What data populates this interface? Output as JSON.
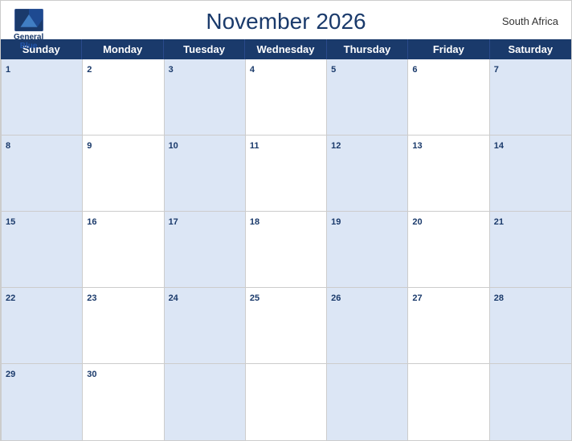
{
  "header": {
    "title": "November 2026",
    "country": "South Africa",
    "logo": {
      "line1": "General",
      "line2": "Blue"
    }
  },
  "days_of_week": [
    "Sunday",
    "Monday",
    "Tuesday",
    "Wednesday",
    "Thursday",
    "Friday",
    "Saturday"
  ],
  "weeks": [
    [
      {
        "date": 1,
        "shaded": true
      },
      {
        "date": 2,
        "shaded": false
      },
      {
        "date": 3,
        "shaded": true
      },
      {
        "date": 4,
        "shaded": false
      },
      {
        "date": 5,
        "shaded": true
      },
      {
        "date": 6,
        "shaded": false
      },
      {
        "date": 7,
        "shaded": true
      }
    ],
    [
      {
        "date": 8,
        "shaded": true
      },
      {
        "date": 9,
        "shaded": false
      },
      {
        "date": 10,
        "shaded": true
      },
      {
        "date": 11,
        "shaded": false
      },
      {
        "date": 12,
        "shaded": true
      },
      {
        "date": 13,
        "shaded": false
      },
      {
        "date": 14,
        "shaded": true
      }
    ],
    [
      {
        "date": 15,
        "shaded": true
      },
      {
        "date": 16,
        "shaded": false
      },
      {
        "date": 17,
        "shaded": true
      },
      {
        "date": 18,
        "shaded": false
      },
      {
        "date": 19,
        "shaded": true
      },
      {
        "date": 20,
        "shaded": false
      },
      {
        "date": 21,
        "shaded": true
      }
    ],
    [
      {
        "date": 22,
        "shaded": true
      },
      {
        "date": 23,
        "shaded": false
      },
      {
        "date": 24,
        "shaded": true
      },
      {
        "date": 25,
        "shaded": false
      },
      {
        "date": 26,
        "shaded": true
      },
      {
        "date": 27,
        "shaded": false
      },
      {
        "date": 28,
        "shaded": true
      }
    ],
    [
      {
        "date": 29,
        "shaded": true
      },
      {
        "date": 30,
        "shaded": false
      },
      {
        "date": null,
        "shaded": true
      },
      {
        "date": null,
        "shaded": false
      },
      {
        "date": null,
        "shaded": true
      },
      {
        "date": null,
        "shaded": false
      },
      {
        "date": null,
        "shaded": true
      }
    ]
  ],
  "accent_color": "#1a3a6b",
  "shaded_color": "#dce6f5"
}
